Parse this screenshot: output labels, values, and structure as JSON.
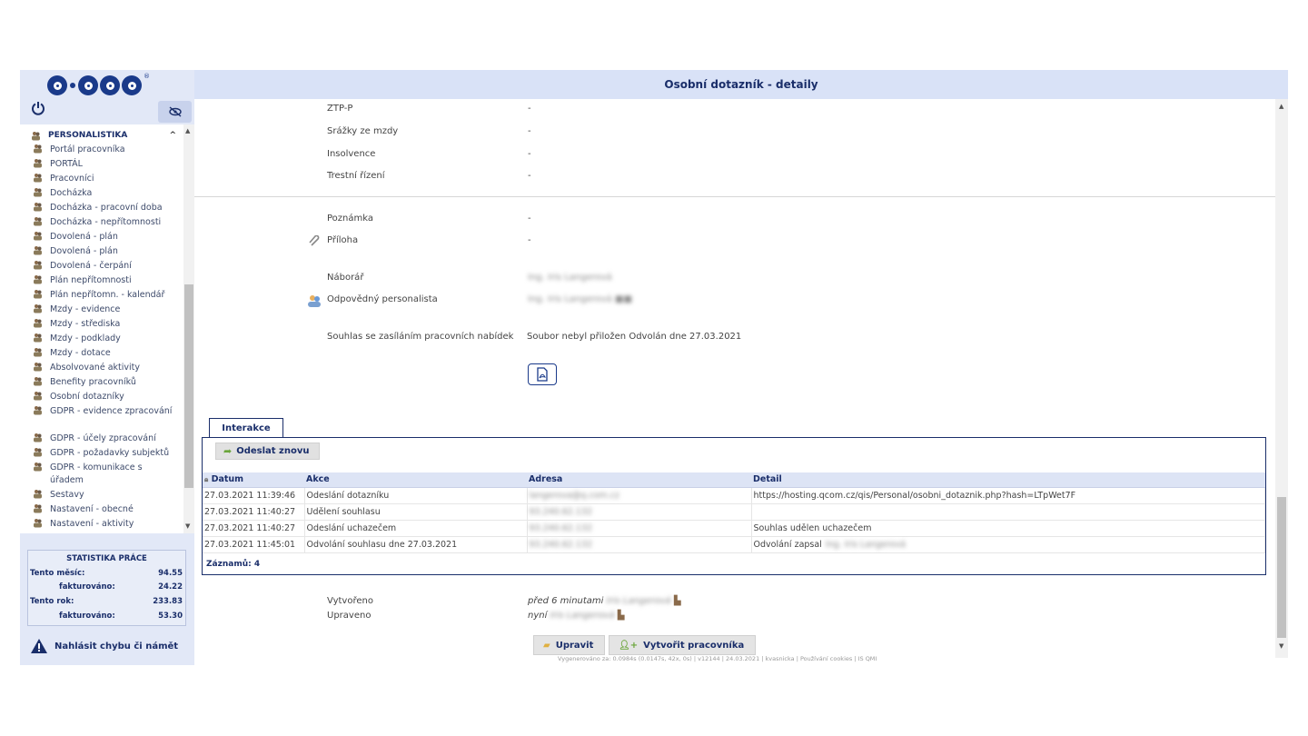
{
  "header": {
    "title": "Osobní dotazník - detaily"
  },
  "sidebar": {
    "logo_text": "Q·COM",
    "section": "PERSONALISTIKA",
    "items": [
      "Portál pracovníka",
      "PORTÁL",
      "Pracovníci",
      "Docházka",
      "Docházka - pracovní doba",
      "Docházka - nepřítomnosti",
      "Dovolená - plán",
      "Dovolená - plán",
      "Dovolená - čerpání",
      "Plán nepřítomnosti",
      "Plán nepřítomn. - kalendář",
      "Mzdy - evidence",
      "Mzdy - střediska",
      "Mzdy - podklady",
      "Mzdy - dotace",
      "Absolvované aktivity",
      "Benefity pracovníků",
      "Osobní dotazníky",
      "GDPR - evidence zpracování",
      "GDPR - účely zpracování",
      "GDPR - požadavky subjektů",
      "GDPR - komunikace s úřadem",
      "Sestavy",
      "Nastavení - obecné",
      "Nastavení - aktivity"
    ],
    "stats": {
      "title": "STATISTIKA PRÁCE",
      "month_label": "Tento měsíc:",
      "month_value": "94.55",
      "month_inv_label": "fakturováno:",
      "month_inv_value": "24.22",
      "year_label": "Tento rok:",
      "year_value": "233.83",
      "year_inv_label": "fakturováno:",
      "year_inv_value": "53.30"
    },
    "report": "Nahlásit chybu či námět"
  },
  "fields": {
    "ztp_label": "ZTP-P",
    "ztp_value": "-",
    "srazky_label": "Srážky ze mzdy",
    "srazky_value": "-",
    "insolvence_label": "Insolvence",
    "insolvence_value": "-",
    "trestni_label": "Trestní řízení",
    "trestni_value": "-",
    "poznamka_label": "Poznámka",
    "poznamka_value": "-",
    "priloha_label": "Příloha",
    "priloha_value": "-",
    "naborar_label": "Náborář",
    "naborar_value": "Ing. Iris Langerová",
    "personalista_label": "Odpovědný personalista",
    "personalista_value": "Ing. Iris Langerová ■■",
    "souhlas_label": "Souhlas se zasíláním pracovních nabídek",
    "souhlas_value": "Soubor nebyl přiložen Odvolán dne 27.03.2021"
  },
  "interactions": {
    "tab": "Interakce",
    "resend_button": "Odeslat znovu",
    "columns": [
      "Datum",
      "Akce",
      "Adresa",
      "Detail"
    ],
    "rows": [
      {
        "date": "27.03.2021 11:39:46",
        "action": "Odeslání dotazníku",
        "address": "langerova@q.com.cz",
        "detail": "https://hosting.qcom.cz/qis/Personal/osobni_dotaznik.php?hash=LTpWet7F",
        "detail_blur": ""
      },
      {
        "date": "27.03.2021 11:40:27",
        "action": "Udělení souhlasu",
        "address": "93.240.62.132",
        "detail": "",
        "detail_blur": ""
      },
      {
        "date": "27.03.2021 11:40:27",
        "action": "Odeslání uchazečem",
        "address": "93.240.62.132",
        "detail": "Souhlas udělen uchazečem",
        "detail_blur": ""
      },
      {
        "date": "27.03.2021 11:45:01",
        "action": "Odvolání souhlasu dne 27.03.2021",
        "address": "93.240.62.132",
        "detail": "Odvolání zapsal",
        "detail_blur": "Ing. Iris Langerová"
      }
    ],
    "records": "Záznamů: 4"
  },
  "meta": {
    "created_label": "Vytvořeno",
    "created_value": "před 6 minutami",
    "created_user": "Iris Langerová",
    "updated_label": "Upraveno",
    "updated_value": "nyní",
    "updated_user": "Iris Langerová"
  },
  "buttons": {
    "edit": "Upravit",
    "create_worker": "Vytvořit pracovníka"
  },
  "footer": "Vygenerováno za: 0.0984s (0.0147s, 42x, 0s) | v12144 | 24.03.2021 | kvasnicka | Používání cookies | IS QMI",
  "colors": {
    "brand": "#1a3a8a",
    "header_bg": "#d9e2f7",
    "sidebar_bg": "#e2e8f7"
  }
}
